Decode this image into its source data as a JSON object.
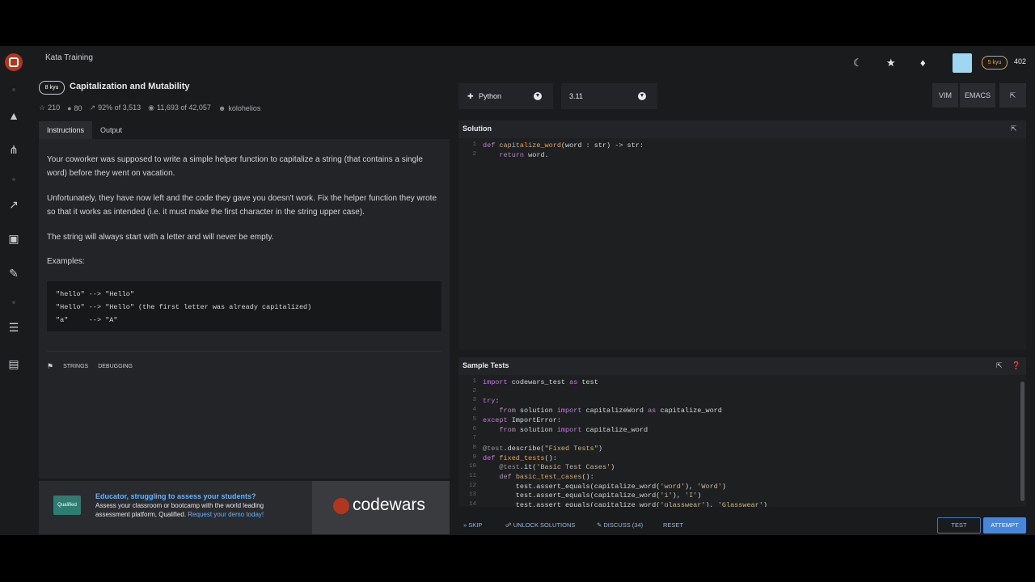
{
  "breadcrumb": "Kata Training",
  "kata": {
    "rank": "8 kyu",
    "title": "Capitalization and Mutability",
    "stats": {
      "stars": "210",
      "collections": "80",
      "satisfaction": "92% of 3,513",
      "completed": "11,693 of 42,057",
      "author": "kolohelios"
    }
  },
  "tabs": [
    "Instructions",
    "Output"
  ],
  "instructions": {
    "paragraphs": [
      "Your coworker was supposed to write a simple helper function to capitalize a string (that contains a single word) before they went on vacation.",
      "Unfortunately, they have now left and the code they gave you doesn't work. Fix the helper function they wrote so that it works as intended (i.e. it must make the first character in the string upper case).",
      "The string will always start with a letter and will never be empty.",
      "Examples:"
    ],
    "examples": [
      "\"hello\" --> \"Hello\"",
      "\"Hello\" --> \"Hello\" (the first letter was already capitalized)",
      "\"a\"     --> \"A\""
    ],
    "tags": [
      "STRINGS",
      "DEBUGGING"
    ]
  },
  "promo": {
    "badge": "Qualified",
    "heading": "Educator, struggling to assess your students?",
    "body": "Assess your classroom or bootcamp with the world leading assessment platform, Qualified.",
    "link": "Request your demo today!",
    "brand": "codewars"
  },
  "header": {
    "user_rank": "5 kyu",
    "honor": "402"
  },
  "editor": {
    "language": "Python",
    "version": "3.11",
    "modes": [
      "VIM",
      "EMACS"
    ],
    "solution_title": "Solution",
    "solution_lines": [
      {
        "n": "1",
        "parts": [
          [
            "kw",
            "def "
          ],
          [
            "fn",
            "capitalize_word"
          ],
          [
            "",
            "(word : str) -> str:"
          ]
        ]
      },
      {
        "n": "2",
        "parts": [
          [
            "",
            "    "
          ],
          [
            "kw",
            "return"
          ],
          [
            "",
            " word."
          ]
        ]
      }
    ],
    "tests_title": "Sample Tests",
    "test_lines": [
      {
        "n": "1",
        "parts": [
          [
            "kw",
            "import"
          ],
          [
            "",
            " codewars_test "
          ],
          [
            "kw",
            "as"
          ],
          [
            "",
            " test"
          ]
        ]
      },
      {
        "n": "2",
        "parts": []
      },
      {
        "n": "3",
        "parts": [
          [
            "kw",
            "try"
          ],
          [
            "",
            ":"
          ]
        ]
      },
      {
        "n": "4",
        "parts": [
          [
            "",
            "    "
          ],
          [
            "kw",
            "from"
          ],
          [
            "",
            " solution "
          ],
          [
            "kw",
            "import"
          ],
          [
            "",
            " capitalizeWord "
          ],
          [
            "kw",
            "as"
          ],
          [
            "",
            " capitalize_word"
          ]
        ]
      },
      {
        "n": "5",
        "parts": [
          [
            "kw",
            "except"
          ],
          [
            "",
            " ImportError:"
          ]
        ]
      },
      {
        "n": "6",
        "parts": [
          [
            "",
            "    "
          ],
          [
            "kw",
            "from"
          ],
          [
            "",
            " solution "
          ],
          [
            "kw",
            "import"
          ],
          [
            "",
            " capitalize_word"
          ]
        ]
      },
      {
        "n": "7",
        "parts": []
      },
      {
        "n": "8",
        "parts": [
          [
            "de",
            "@test"
          ],
          [
            "",
            ".describe("
          ],
          [
            "st",
            "\"Fixed Tests\""
          ],
          [
            "",
            ")"
          ]
        ]
      },
      {
        "n": "9",
        "parts": [
          [
            "kw",
            "def "
          ],
          [
            "fn",
            "fixed_tests"
          ],
          [
            "",
            "():"
          ]
        ]
      },
      {
        "n": "10",
        "parts": [
          [
            "",
            "    "
          ],
          [
            "de",
            "@test"
          ],
          [
            "",
            ".it("
          ],
          [
            "st",
            "'Basic Test Cases'"
          ],
          [
            "",
            ")"
          ]
        ]
      },
      {
        "n": "11",
        "parts": [
          [
            "",
            "    "
          ],
          [
            "kw",
            "def "
          ],
          [
            "fn",
            "basic_test_cases"
          ],
          [
            "",
            "():"
          ]
        ]
      },
      {
        "n": "12",
        "parts": [
          [
            "",
            "        test.assert_equals(capitalize_word("
          ],
          [
            "st",
            "'word'"
          ],
          [
            "",
            "), "
          ],
          [
            "st",
            "'Word'"
          ],
          [
            "",
            ")"
          ]
        ]
      },
      {
        "n": "13",
        "parts": [
          [
            "",
            "        test.assert_equals(capitalize_word("
          ],
          [
            "st",
            "'i'"
          ],
          [
            "",
            "), "
          ],
          [
            "st",
            "'I'"
          ],
          [
            "",
            ")"
          ]
        ]
      },
      {
        "n": "14",
        "parts": [
          [
            "",
            "        test.assert_equals(capitalize_word("
          ],
          [
            "st",
            "'glasswear'"
          ],
          [
            "",
            "), "
          ],
          [
            "st",
            "'Glasswear'"
          ],
          [
            "",
            ")"
          ]
        ]
      }
    ]
  },
  "bottom": {
    "skip": "SKIP",
    "unlock": "UNLOCK SOLUTIONS",
    "discuss": "DISCUSS (34)",
    "reset": "RESET",
    "test": "TEST",
    "attempt": "ATTEMPT"
  }
}
